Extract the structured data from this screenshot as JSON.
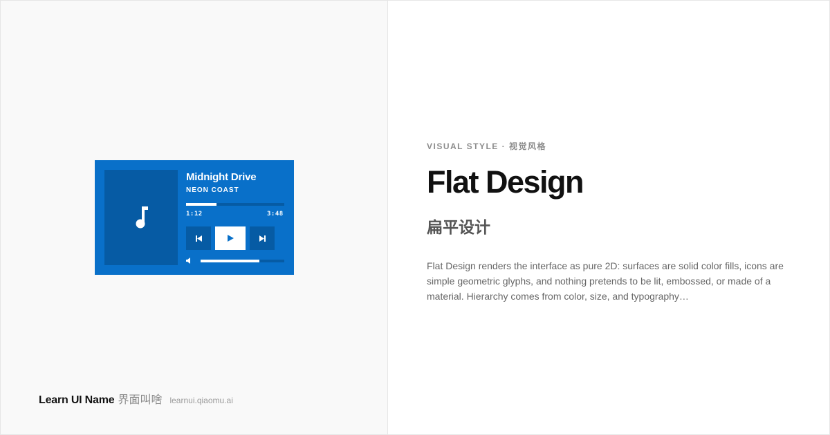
{
  "player": {
    "track_title": "Midnight Drive",
    "artist": "NEON COAST",
    "time_elapsed": "1:12",
    "time_total": "3:48",
    "progress_fraction": 0.31,
    "volume_fraction": 0.7,
    "icons": {
      "art": "music-note-icon",
      "prev": "skip-previous-icon",
      "play": "play-icon",
      "next": "skip-next-icon",
      "volume": "volume-icon"
    },
    "colors": {
      "card": "#0970c9",
      "card_dark": "#065ba4",
      "foreground": "#ffffff"
    }
  },
  "brand": {
    "name": "Learn UI Name",
    "name_cn": "界面叫啥",
    "url": "learnui.qiaomu.ai"
  },
  "style": {
    "eyebrow": "VISUAL STYLE · 视觉风格",
    "title": "Flat Design",
    "title_cn": "扁平设计",
    "description": "Flat Design renders the interface as pure 2D: surfaces are solid color fills, icons are simple geometric glyphs, and nothing pretends to be lit, embossed, or made of a material. Hierarchy comes from color, size, and typography…"
  }
}
